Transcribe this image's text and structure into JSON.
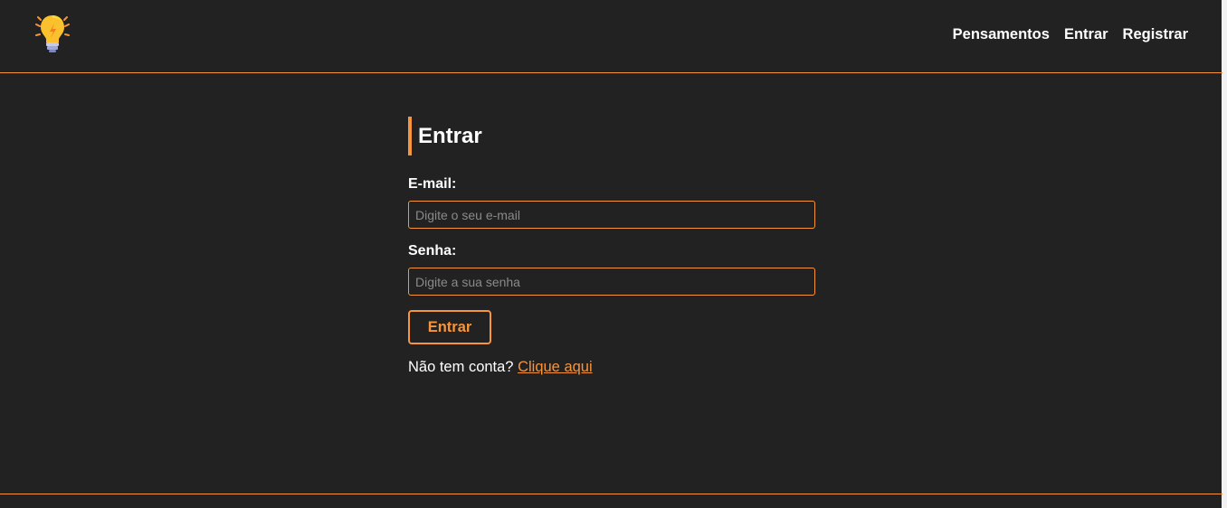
{
  "colors": {
    "background": "#222222",
    "accent": "#f6953b",
    "text": "#ffffff"
  },
  "navbar": {
    "logo_icon": "lightbulb-icon",
    "links": [
      "Pensamentos",
      "Entrar",
      "Registrar"
    ]
  },
  "login_form": {
    "title": "Entrar",
    "email_label": "E-mail:",
    "email_placeholder": "Digite o seu e-mail",
    "email_value": "",
    "password_label": "Senha:",
    "password_placeholder": "Digite a sua senha",
    "password_value": "",
    "submit_label": "Entrar",
    "register_prompt": "Não tem conta?",
    "register_link": "Clique aqui"
  }
}
